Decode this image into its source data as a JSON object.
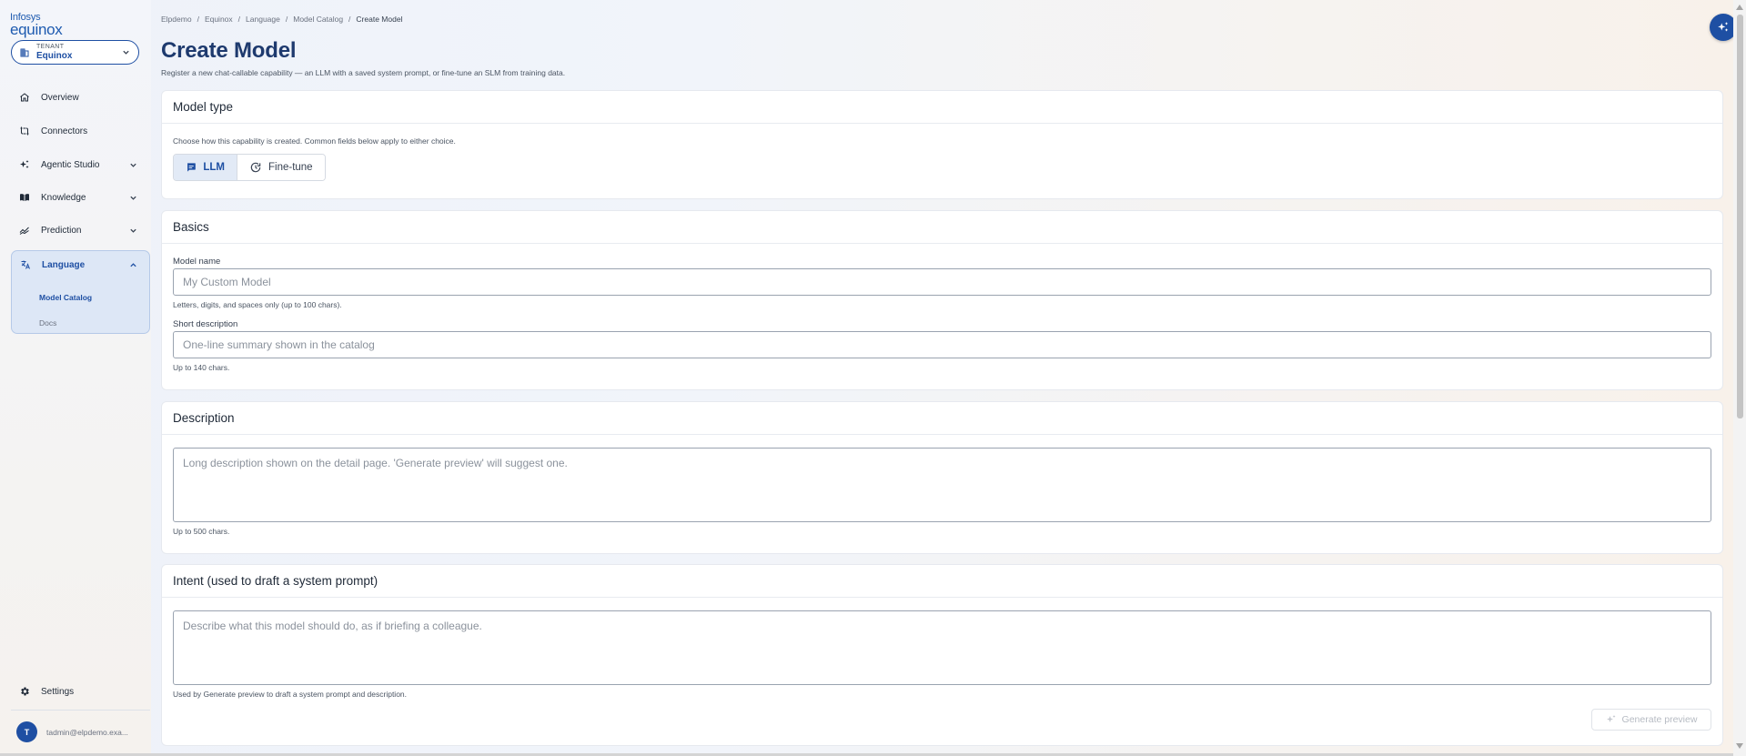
{
  "brand": {
    "line1": "Infosys",
    "line2": "equinox"
  },
  "tenant": {
    "caption": "TENANT",
    "name": "Equinox"
  },
  "sidebar": {
    "items": [
      {
        "label": "Overview",
        "icon": "home-icon"
      },
      {
        "label": "Connectors",
        "icon": "connectors-icon"
      },
      {
        "label": "Agentic Studio",
        "icon": "sparkles-icon"
      },
      {
        "label": "Knowledge",
        "icon": "book-icon"
      },
      {
        "label": "Prediction",
        "icon": "chart-line-icon"
      }
    ],
    "language": {
      "label": "Language",
      "icon": "translate-icon",
      "sub": [
        {
          "label": "Model Catalog",
          "active": true
        },
        {
          "label": "Docs",
          "active": false
        }
      ]
    },
    "settings": "Settings",
    "user": {
      "initial": "T",
      "email": "tadmin@elpdemo.exa..."
    }
  },
  "breadcrumb": [
    "Elpdemo",
    "Equinox",
    "Language",
    "Model Catalog",
    "Create Model"
  ],
  "page": {
    "title": "Create Model",
    "subtitle": "Register a new chat-callable capability — an LLM with a saved system prompt, or fine-tune an SLM from training data."
  },
  "model_type": {
    "title": "Model type",
    "hint": "Choose how this capability is created. Common fields below apply to either choice.",
    "options": [
      {
        "label": "LLM",
        "selected": true
      },
      {
        "label": "Fine-tune",
        "selected": false
      }
    ]
  },
  "basics": {
    "title": "Basics",
    "name_label": "Model name",
    "name_placeholder": "My Custom Model",
    "name_value": "",
    "name_hint": "Letters, digits, and spaces only (up to 100 chars).",
    "short_label": "Short description",
    "short_placeholder": "One-line summary shown in the catalog",
    "short_value": "",
    "short_hint": "Up to 140 chars."
  },
  "description": {
    "title": "Description",
    "placeholder": "Long description shown on the detail page. 'Generate preview' will suggest one.",
    "value": "",
    "hint": "Up to 500 chars."
  },
  "intent": {
    "title": "Intent (used to draft a system prompt)",
    "placeholder": "Describe what this model should do, as if briefing a colleague.",
    "value": "",
    "hint": "Used by Generate preview to draft a system prompt and description.",
    "generate_label": "Generate preview",
    "generate_enabled": false
  },
  "colors": {
    "primary": "#1e4fa3",
    "title": "#1e3a6e",
    "active_bg": "#dde7f6"
  }
}
